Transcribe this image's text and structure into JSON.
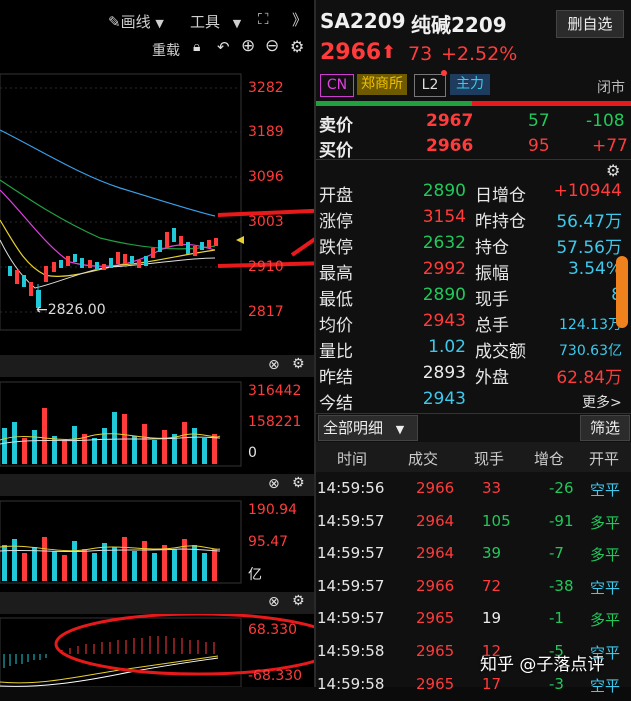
{
  "toolbar": {
    "draw_label": "画线",
    "tools_label": "工具",
    "reset_label": "重载",
    "expand_label": "》"
  },
  "chart_axis": {
    "price": [
      "3282",
      "3189",
      "3096",
      "3003",
      "2910",
      "2817"
    ],
    "low_marker": "←2826.00",
    "vol": [
      "316442",
      "158221",
      "0"
    ],
    "amount": [
      "190.94",
      "95.47",
      "亿"
    ],
    "osc": [
      "68.330",
      "-68.330"
    ]
  },
  "quote": {
    "symbol": "SA2209",
    "name": "纯碱2209",
    "watch_button": "删自选",
    "price": "2966",
    "change": "73",
    "change_pct": "+2.52%",
    "tags": [
      "CN",
      "郑商所",
      "L2",
      "主力"
    ],
    "status": "闭市"
  },
  "orderbook": {
    "sell_label": "卖价",
    "sell_price": "2967",
    "sell_qty": "57",
    "sell_delta": "-108",
    "buy_label": "买价",
    "buy_price": "2966",
    "buy_qty": "95",
    "buy_delta": "+77"
  },
  "stats": {
    "left": [
      {
        "label": "开盘",
        "value": "2890",
        "color": "green"
      },
      {
        "label": "涨停",
        "value": "3154",
        "color": "red"
      },
      {
        "label": "跌停",
        "value": "2632",
        "color": "green"
      },
      {
        "label": "最高",
        "value": "2992",
        "color": "red"
      },
      {
        "label": "最低",
        "value": "2890",
        "color": "green"
      },
      {
        "label": "均价",
        "value": "2943",
        "color": "red"
      },
      {
        "label": "量比",
        "value": "1.02",
        "color": "cyan"
      },
      {
        "label": "昨结",
        "value": "2893",
        "color": "white"
      },
      {
        "label": "今结",
        "value": "2943",
        "color": "cyan"
      }
    ],
    "right": [
      {
        "label": "日增仓",
        "value": "+10944",
        "color": "red"
      },
      {
        "label": "昨持仓",
        "value": "56.47万",
        "color": "cyan"
      },
      {
        "label": "持仓",
        "value": "57.56万",
        "color": "cyan"
      },
      {
        "label": "振幅",
        "value": "3.54%",
        "color": "cyan"
      },
      {
        "label": "现手",
        "value": "8",
        "color": "cyan"
      },
      {
        "label": "总手",
        "value": "124.13万",
        "color": "cyan"
      },
      {
        "label": "成交额",
        "value": "730.63亿",
        "color": "cyan"
      },
      {
        "label": "外盘",
        "value": "62.84万",
        "color": "red"
      }
    ],
    "more": "更多>"
  },
  "detail": {
    "filter_label": "全部明细",
    "screen_button": "筛选",
    "headers": [
      "时间",
      "成交",
      "现手",
      "增仓",
      "开平"
    ],
    "rows": [
      {
        "time": "14:59:56",
        "price": "2966",
        "qty": "33",
        "delta": "-26",
        "type": "空平",
        "qtyColor": "red",
        "typeColor": "cyan"
      },
      {
        "time": "14:59:57",
        "price": "2964",
        "qty": "105",
        "delta": "-91",
        "type": "多平",
        "qtyColor": "green",
        "typeColor": "green"
      },
      {
        "time": "14:59:57",
        "price": "2964",
        "qty": "39",
        "delta": "-7",
        "type": "多平",
        "qtyColor": "green",
        "typeColor": "green"
      },
      {
        "time": "14:59:57",
        "price": "2966",
        "qty": "72",
        "delta": "-38",
        "type": "空平",
        "qtyColor": "red",
        "typeColor": "cyan"
      },
      {
        "time": "14:59:57",
        "price": "2965",
        "qty": "19",
        "delta": "-1",
        "type": "多平",
        "qtyColor": "white",
        "typeColor": "green"
      },
      {
        "time": "14:59:58",
        "price": "2965",
        "qty": "12",
        "delta": "-5",
        "type": "空平",
        "qtyColor": "red",
        "typeColor": "cyan"
      },
      {
        "time": "14:59:58",
        "price": "2965",
        "qty": "17",
        "delta": "-3",
        "type": "空平",
        "qtyColor": "red",
        "typeColor": "cyan"
      }
    ]
  },
  "watermark": "知乎 @子落点评"
}
